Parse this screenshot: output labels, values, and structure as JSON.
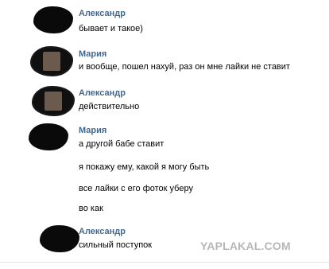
{
  "messages": [
    {
      "author": "Александр",
      "lines": [
        "бывает и такое)"
      ]
    },
    {
      "author": "Мария",
      "lines": [
        "и вообще, пошел нахуй, раз он мне лайки не ставит"
      ]
    },
    {
      "author": "Александр",
      "lines": [
        "действительно"
      ]
    },
    {
      "author": "Мария",
      "lines": [
        "а другой бабе ставит",
        "я покажу ему, какой я могу быть",
        "все лайки с его фоток уберу",
        "во как"
      ]
    },
    {
      "author": "Александр",
      "lines": [
        "сильный поступок"
      ]
    }
  ],
  "watermark": "YAPLAKAL.COM",
  "colors": {
    "author": "#45688e",
    "text": "#000000",
    "watermark": "#b7b7b7"
  }
}
